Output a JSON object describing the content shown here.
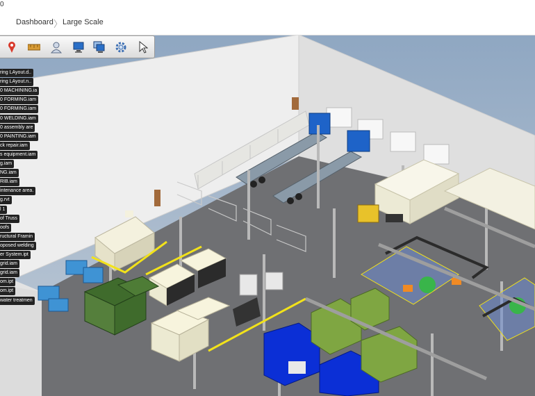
{
  "window": {
    "title_fragment": "0"
  },
  "breadcrumb": {
    "home": "Dashboard",
    "current": "Large Scale",
    "separator": "〉"
  },
  "toolbar": {
    "icons": [
      "map-pin",
      "ruler",
      "person",
      "monitor",
      "layers",
      "gear",
      "pointer"
    ]
  },
  "tree": {
    "items": [
      "ring LAyout.d..",
      "ring LAyout.n..",
      "0 MACHINING.ia",
      "0 FORMING.iam",
      "0 FORMING.iam",
      "0 WELDING.iam",
      "0 assembly are",
      "0 PAINTING.iam",
      "ck repair.iam",
      "s equipment.iam",
      "g.iam",
      "NG.iam",
      "RIB.iam",
      "intenance area.",
      "g.rvt",
      "l 1",
      "of Truss",
      "oofs",
      "ructural Framin",
      "oposed welding",
      "er System.ipt",
      "grid.iam",
      "grid.iam",
      "om.ipt",
      "om.ipt",
      "water treatmen"
    ]
  },
  "colors": {
    "floor": "#6f7073",
    "wall": "#e9e9e9",
    "sky": "#a9b9ca",
    "truck": "#1e63c8",
    "machine_blue": "#0b2fd6",
    "machine_green": "#7fa642",
    "safety_yellow": "#f2e21a"
  }
}
